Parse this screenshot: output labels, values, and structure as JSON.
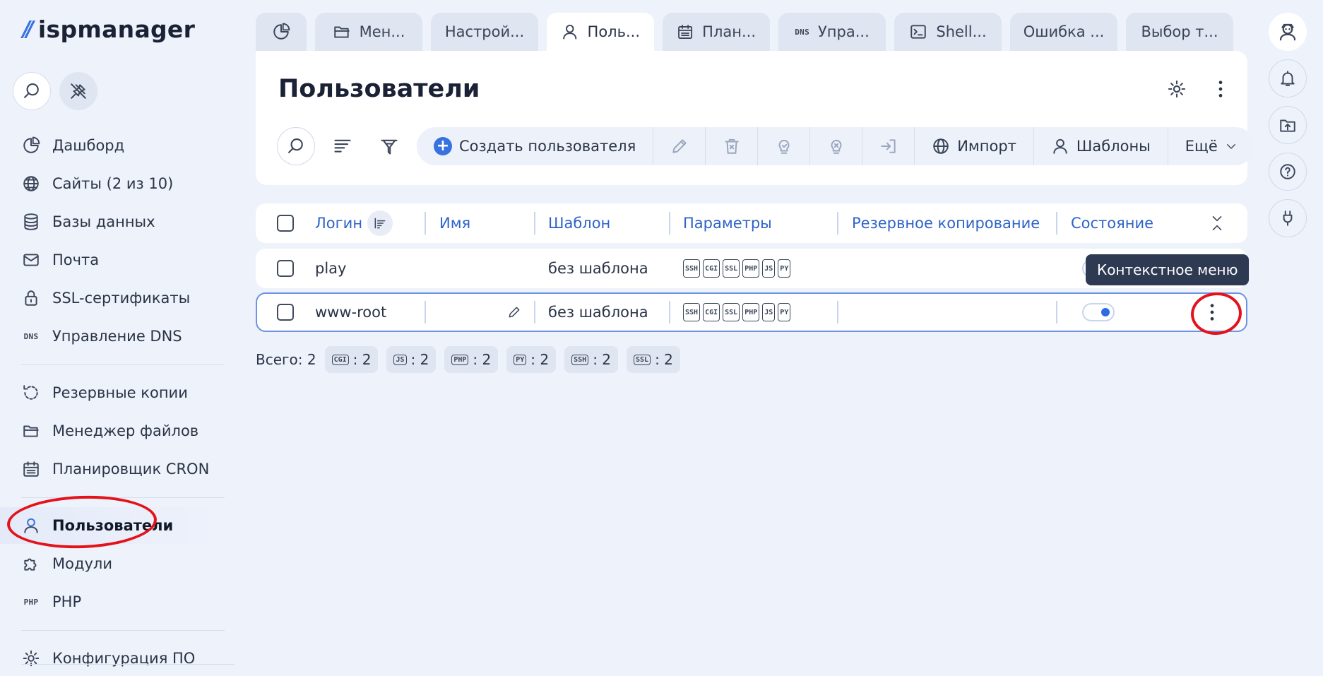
{
  "brand": {
    "mark": "//",
    "name": "ispmanager"
  },
  "sidebar": {
    "items": [
      {
        "label": "Дашборд",
        "icon": "pie-chart-icon"
      },
      {
        "label": "Сайты (2 из 10)",
        "icon": "globe-icon"
      },
      {
        "label": "Базы данных",
        "icon": "database-icon"
      },
      {
        "label": "Почта",
        "icon": "mail-icon"
      },
      {
        "label": "SSL-сертификаты",
        "icon": "lock-icon"
      },
      {
        "label": "Управление DNS",
        "icon": "dns-icon",
        "glyph": "DNS"
      },
      {
        "label": "Резервные копии",
        "icon": "backup-icon"
      },
      {
        "label": "Менеджер файлов",
        "icon": "folder-icon"
      },
      {
        "label": "Планировщик CRON",
        "icon": "calendar-icon"
      },
      {
        "label": "Пользователи",
        "icon": "user-icon",
        "active": true
      },
      {
        "label": "Модули",
        "icon": "puzzle-icon"
      },
      {
        "label": "PHP",
        "icon": "php-icon",
        "glyph": "PHP"
      },
      {
        "label": "Конфигурация ПО",
        "icon": "gear-icon"
      }
    ]
  },
  "tabs": [
    {
      "label": "",
      "icon": "pie-chart-icon"
    },
    {
      "label": "Мен...",
      "icon": "folder-icon"
    },
    {
      "label": "Настрой...",
      "icon": ""
    },
    {
      "label": "Поль...",
      "icon": "user-icon",
      "active": true
    },
    {
      "label": "План...",
      "icon": "calendar-icon"
    },
    {
      "label": "Упра...",
      "icon": "dns-icon",
      "glyph": "DNS"
    },
    {
      "label": "Shell...",
      "icon": "terminal-icon"
    },
    {
      "label": "Ошибка ...",
      "icon": ""
    },
    {
      "label": "Выбор т...",
      "icon": ""
    }
  ],
  "page": {
    "title": "Пользователи"
  },
  "toolbar": {
    "create_label": "Создать пользователя",
    "import_label": "Импорт",
    "templates_label": "Шаблоны",
    "more_label": "Ещё"
  },
  "table": {
    "columns": [
      "Логин",
      "Имя",
      "Шаблон",
      "Параметры",
      "Резервное копирование",
      "Состояние"
    ],
    "rows": [
      {
        "login": "play",
        "name": "",
        "template": "без шаблона",
        "params": [
          "SSH",
          "CGI",
          "SSL",
          "PHP",
          "JS",
          "PY"
        ],
        "backup": "",
        "enabled": true
      },
      {
        "login": "www-root",
        "name": "",
        "template": "без шаблона",
        "params": [
          "SSH",
          "CGI",
          "SSL",
          "PHP",
          "JS",
          "PY"
        ],
        "backup": "",
        "enabled": true
      }
    ]
  },
  "tooltip": {
    "text": "Контекстное меню"
  },
  "totals": {
    "label": "Всего: 2",
    "chips": [
      {
        "glyph": "CGI",
        "value": ": 2"
      },
      {
        "glyph": "JS",
        "value": ": 2"
      },
      {
        "glyph": "PHP",
        "value": ": 2"
      },
      {
        "glyph": "PY",
        "value": ": 2"
      },
      {
        "glyph": "SSH",
        "value": ": 2"
      },
      {
        "glyph": "SSL",
        "value": ": 2"
      }
    ]
  },
  "colors": {
    "accent": "#3872e0",
    "link": "#2e63c9",
    "annotation": "#e3121b",
    "tooltip_bg": "#2e3a52"
  }
}
